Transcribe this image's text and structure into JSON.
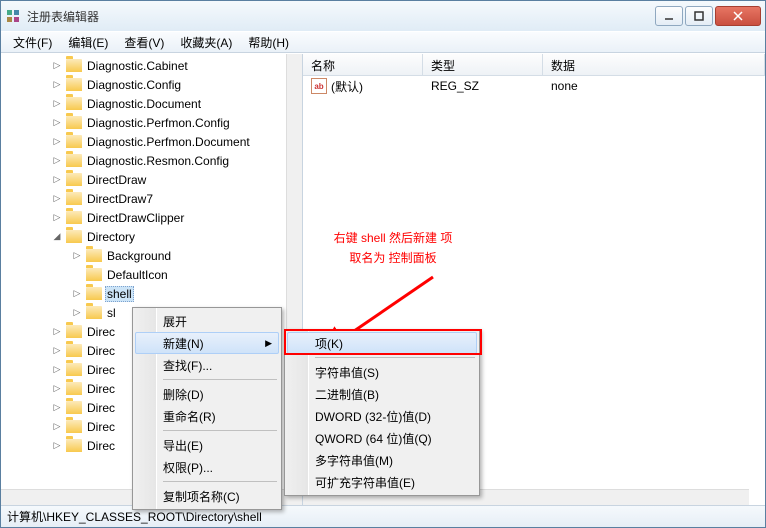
{
  "window": {
    "title": "注册表编辑器"
  },
  "menubar": [
    {
      "label": "文件(F)"
    },
    {
      "label": "编辑(E)"
    },
    {
      "label": "查看(V)"
    },
    {
      "label": "收藏夹(A)"
    },
    {
      "label": "帮助(H)"
    }
  ],
  "tree": [
    {
      "indent": 50,
      "exp": "▷",
      "label": "Diagnostic.Cabinet"
    },
    {
      "indent": 50,
      "exp": "▷",
      "label": "Diagnostic.Config"
    },
    {
      "indent": 50,
      "exp": "▷",
      "label": "Diagnostic.Document"
    },
    {
      "indent": 50,
      "exp": "▷",
      "label": "Diagnostic.Perfmon.Config"
    },
    {
      "indent": 50,
      "exp": "▷",
      "label": "Diagnostic.Perfmon.Document"
    },
    {
      "indent": 50,
      "exp": "▷",
      "label": "Diagnostic.Resmon.Config"
    },
    {
      "indent": 50,
      "exp": "▷",
      "label": "DirectDraw"
    },
    {
      "indent": 50,
      "exp": "▷",
      "label": "DirectDraw7"
    },
    {
      "indent": 50,
      "exp": "▷",
      "label": "DirectDrawClipper"
    },
    {
      "indent": 50,
      "exp": "◢",
      "label": "Directory"
    },
    {
      "indent": 70,
      "exp": "▷",
      "label": "Background"
    },
    {
      "indent": 70,
      "exp": "",
      "label": "DefaultIcon"
    },
    {
      "indent": 70,
      "exp": "▷",
      "label": "shell",
      "sel": true
    },
    {
      "indent": 70,
      "exp": "▷",
      "label": "sl"
    },
    {
      "indent": 50,
      "exp": "▷",
      "label": "Direc"
    },
    {
      "indent": 50,
      "exp": "▷",
      "label": "Direc"
    },
    {
      "indent": 50,
      "exp": "▷",
      "label": "Direc"
    },
    {
      "indent": 50,
      "exp": "▷",
      "label": "Direc"
    },
    {
      "indent": 50,
      "exp": "▷",
      "label": "Direc"
    },
    {
      "indent": 50,
      "exp": "▷",
      "label": "Direc"
    },
    {
      "indent": 50,
      "exp": "▷",
      "label": "Direc"
    }
  ],
  "list": {
    "cols": {
      "name": "名称",
      "type": "类型",
      "data": "数据"
    },
    "rows": [
      {
        "name": "(默认)",
        "type": "REG_SZ",
        "data": "none"
      }
    ]
  },
  "statusbar": {
    "path": "计算机\\HKEY_CLASSES_ROOT\\Directory\\shell"
  },
  "ctx1": {
    "expand": "展开",
    "new": "新建(N)",
    "find": "查找(F)...",
    "delete": "删除(D)",
    "rename": "重命名(R)",
    "export": "导出(E)",
    "perm": "权限(P)...",
    "copy": "复制项名称(C)"
  },
  "ctx2": {
    "key": "项(K)",
    "string": "字符串值(S)",
    "binary": "二进制值(B)",
    "dword": "DWORD (32-位)值(D)",
    "qword": "QWORD (64 位)值(Q)",
    "multi": "多字符串值(M)",
    "expand": "可扩充字符串值(E)"
  },
  "annotation": {
    "line1": "右键 shell 然后新建 项",
    "line2": "取名为 控制面板"
  }
}
